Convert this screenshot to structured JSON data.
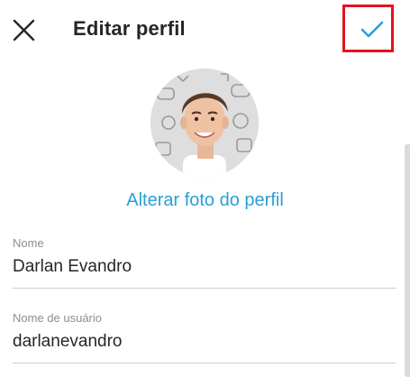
{
  "header": {
    "title": "Editar perfil",
    "close_icon": "close-icon",
    "confirm_icon": "checkmark-icon"
  },
  "profile": {
    "change_photo_label": "Alterar foto do perfil"
  },
  "fields": {
    "name": {
      "label": "Nome",
      "value": "Darlan Evandro"
    },
    "username": {
      "label": "Nome de usuário",
      "value": "darlanevandro"
    }
  },
  "colors": {
    "accent": "#2a9fd6",
    "highlight_box": "#e3141e",
    "text": "#262626",
    "label": "#8e8e8e",
    "divider": "#cfcfcf"
  }
}
